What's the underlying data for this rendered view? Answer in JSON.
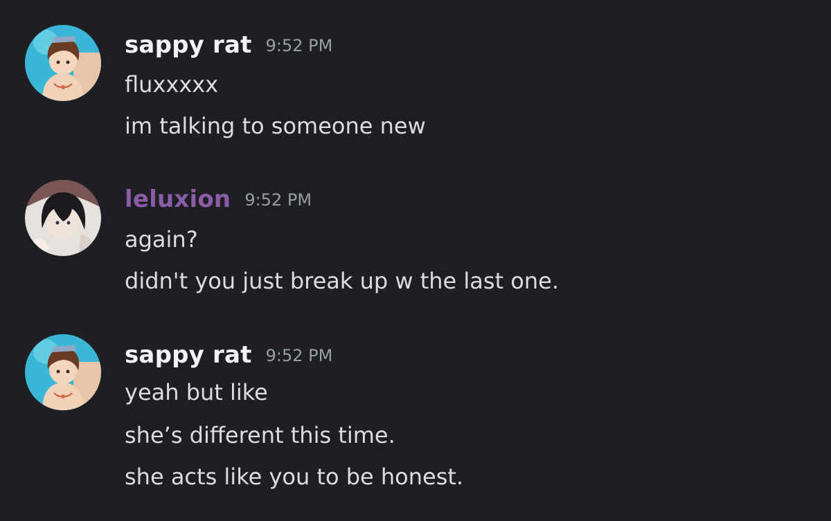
{
  "theme": {
    "background": "#1e1f24",
    "text_color": "#dcdde0",
    "timestamp_color": "#9a9da3"
  },
  "messages": [
    {
      "author": "sappy rat",
      "author_color": "#f2f3f5",
      "time": "9:52 PM",
      "avatar": "anime-boy-avatar-icon",
      "lines": [
        "fluxxxxx",
        "im talking to someone new"
      ]
    },
    {
      "author": "leluxion",
      "author_color": "#8b5ca8",
      "time": "9:52 PM",
      "avatar": "anime-dark-hair-avatar-icon",
      "lines": [
        "again?",
        "didn't you just break up w the last one."
      ]
    },
    {
      "author": "sappy rat",
      "author_color": "#f2f3f5",
      "time": "9:52 PM",
      "avatar": "anime-boy-avatar-icon",
      "lines": [
        "yeah but like",
        "she’s different this time.",
        "she acts like you to be honest."
      ]
    }
  ]
}
